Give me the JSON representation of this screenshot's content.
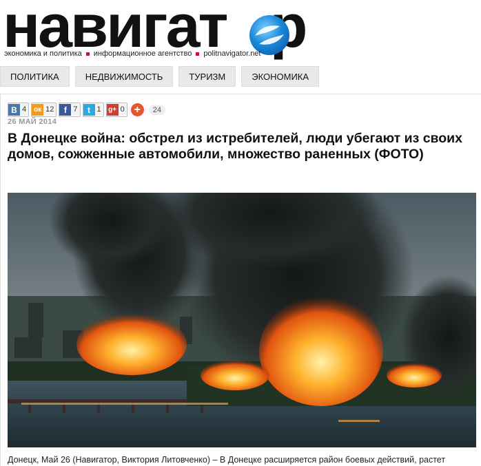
{
  "site": {
    "logo_text": "навигатор",
    "tagline": [
      "экономика и политика",
      "информационное агентство",
      "politnavigator.net"
    ]
  },
  "nav": {
    "items": [
      "ПОЛИТИКА",
      "НЕДВИЖИМОСТЬ",
      "ТУРИЗМ",
      "ЭКОНОМИКА"
    ]
  },
  "share": {
    "vk": {
      "icon": "vk-icon",
      "letter": "В",
      "count": "4",
      "color": "#4a76a8"
    },
    "ok": {
      "icon": "odnoklassniki-icon",
      "letter": "ок",
      "count": "12",
      "color": "#f59a1b"
    },
    "fb": {
      "icon": "facebook-icon",
      "letter": "f",
      "count": "7",
      "color": "#3b5998"
    },
    "tw": {
      "icon": "twitter-icon",
      "letter": "t",
      "count": "1",
      "color": "#2ba9e1"
    },
    "gp": {
      "icon": "google-plus-icon",
      "letter": "g+",
      "count": "0",
      "color": "#d23f31"
    },
    "total": "24"
  },
  "article": {
    "date": "26 МАЙ 2014",
    "title": "В Донецке война: обстрел из истребителей, люди убегают из своих домов, сожженные автомобили, множество раненных (ФОТО)",
    "caption": "Донецк, Май 26 (Навигатор, Виктория Литовченко) –  В Донецке расширяется район боевых действий, растет"
  }
}
